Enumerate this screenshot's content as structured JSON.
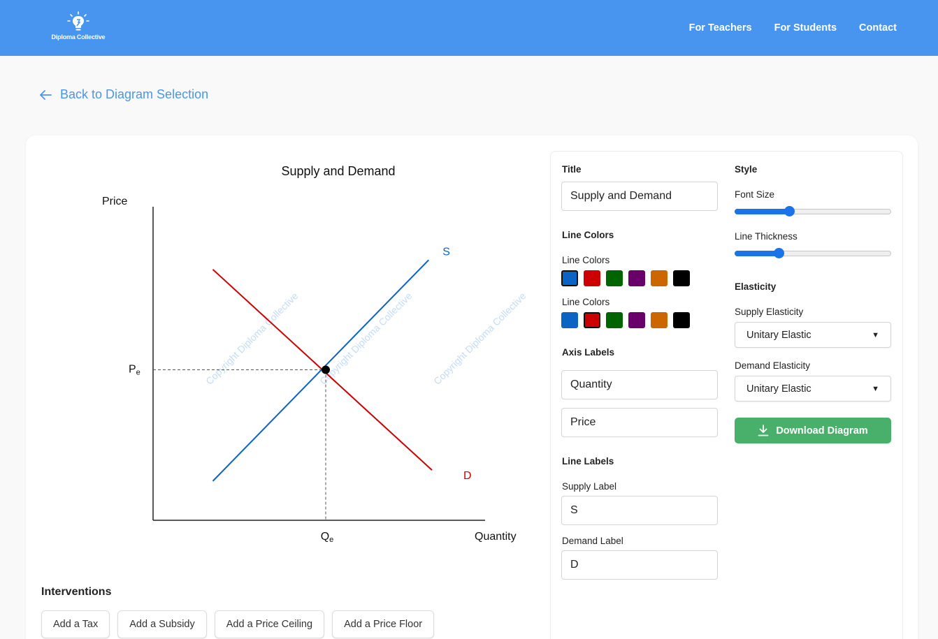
{
  "brand": {
    "name": "Diploma Collective"
  },
  "nav": [
    {
      "label": "For Teachers"
    },
    {
      "label": "For Students"
    },
    {
      "label": "Contact"
    }
  ],
  "back_link": "Back to Diagram Selection",
  "chart": {
    "title": "Supply and Demand",
    "y_axis_label": "Price",
    "x_axis_label": "Quantity",
    "eq_price_label": "Pe",
    "eq_quantity_label": "Qe",
    "supply_label": "S",
    "demand_label": "D",
    "watermark": "Copyright Diploma Collective"
  },
  "chart_data": {
    "type": "line",
    "title": "Supply and Demand",
    "xlabel": "Quantity",
    "ylabel": "Price",
    "xlim": [
      0,
      10
    ],
    "ylim": [
      0,
      10
    ],
    "grid": false,
    "series": [
      {
        "name": "S",
        "x": [
          1.8,
          8.3
        ],
        "y": [
          1.25,
          8.3
        ],
        "color": "#0b63c4"
      },
      {
        "name": "D",
        "x": [
          1.8,
          8.4
        ],
        "y": [
          8.0,
          1.6
        ],
        "color": "#cc0000"
      }
    ],
    "equilibrium": {
      "x": 5.2,
      "y": 4.8,
      "x_label": "Qe",
      "y_label": "Pe"
    }
  },
  "interventions": {
    "title": "Interventions",
    "buttons": [
      "Add a Tax",
      "Add a Subsidy",
      "Add a Price Ceiling",
      "Add a Price Floor"
    ]
  },
  "panel": {
    "title_label": "Title",
    "title_value": "Supply and Demand",
    "line_colors_heading": "Line Colors",
    "supply_colors_label": "Line Colors",
    "demand_colors_label": "Line Colors",
    "palette": [
      "#0b63c4",
      "#cc0000",
      "#006400",
      "#6a006a",
      "#cc6600",
      "#000000"
    ],
    "supply_selected": 0,
    "demand_selected": 1,
    "axis_labels_heading": "Axis Labels",
    "x_axis_value": "Quantity",
    "y_axis_value": "Price",
    "line_labels_heading": "Line Labels",
    "supply_label_label": "Supply Label",
    "supply_label_value": "S",
    "demand_label_label": "Demand Label",
    "demand_label_value": "D",
    "style_heading": "Style",
    "font_size_label": "Font Size",
    "font_size_fraction": 0.34,
    "line_thickness_label": "Line Thickness",
    "line_thickness_fraction": 0.27,
    "elasticity_heading": "Elasticity",
    "supply_elasticity_label": "Supply Elasticity",
    "supply_elasticity_value": "Unitary Elastic",
    "demand_elasticity_label": "Demand Elasticity",
    "demand_elasticity_value": "Unitary Elastic",
    "download_label": "Download Diagram"
  }
}
